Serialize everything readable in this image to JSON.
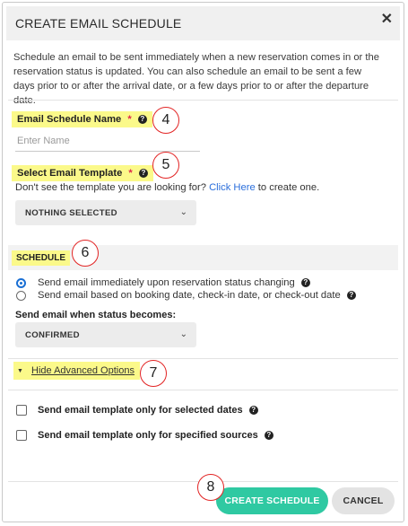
{
  "dialog": {
    "title": "CREATE EMAIL SCHEDULE",
    "close_glyph": "✕",
    "description": "Schedule an email to be sent immediately when a new reservation comes in or the reservation status is updated. You can also schedule an email to be sent a few days prior to or after the arrival date, or a few days prior to or after the departure date."
  },
  "name_field": {
    "label": "Email Schedule Name",
    "required_mark": "*",
    "help_glyph": "?",
    "placeholder": "Enter Name",
    "value": ""
  },
  "template_field": {
    "label": "Select Email Template",
    "required_mark": "*",
    "help_glyph": "?",
    "hint_before": "Don't see the template you are looking for?",
    "hint_link": "Click Here",
    "hint_after": "to create one.",
    "selected": "NOTHING SELECTED",
    "chevron": "⌄"
  },
  "schedule": {
    "heading": "SCHEDULE",
    "options": [
      {
        "label": "Send email immediately upon reservation status changing",
        "checked": true
      },
      {
        "label": "Send email based on booking date, check-in date, or check-out date",
        "checked": false
      }
    ],
    "status_label": "Send email when status becomes:",
    "status_value": "CONFIRMED",
    "chevron": "⌄"
  },
  "advanced": {
    "toggle_glyph": "▼",
    "toggle_label": "Hide Advanced Options",
    "options": [
      {
        "label": "Send email template only for selected dates",
        "checked": false
      },
      {
        "label": "Send email template only for specified sources",
        "checked": false
      }
    ]
  },
  "footer": {
    "create_label": "CREATE SCHEDULE",
    "cancel_label": "CANCEL"
  },
  "callouts": {
    "c4": "4",
    "c5": "5",
    "c6": "6",
    "c7": "7",
    "c8": "8"
  },
  "colors": {
    "highlight": "#fbf98a",
    "primary": "#2fc9a2",
    "radio": "#1a6fd4",
    "callout": "#e22424",
    "required": "#e0284a"
  }
}
